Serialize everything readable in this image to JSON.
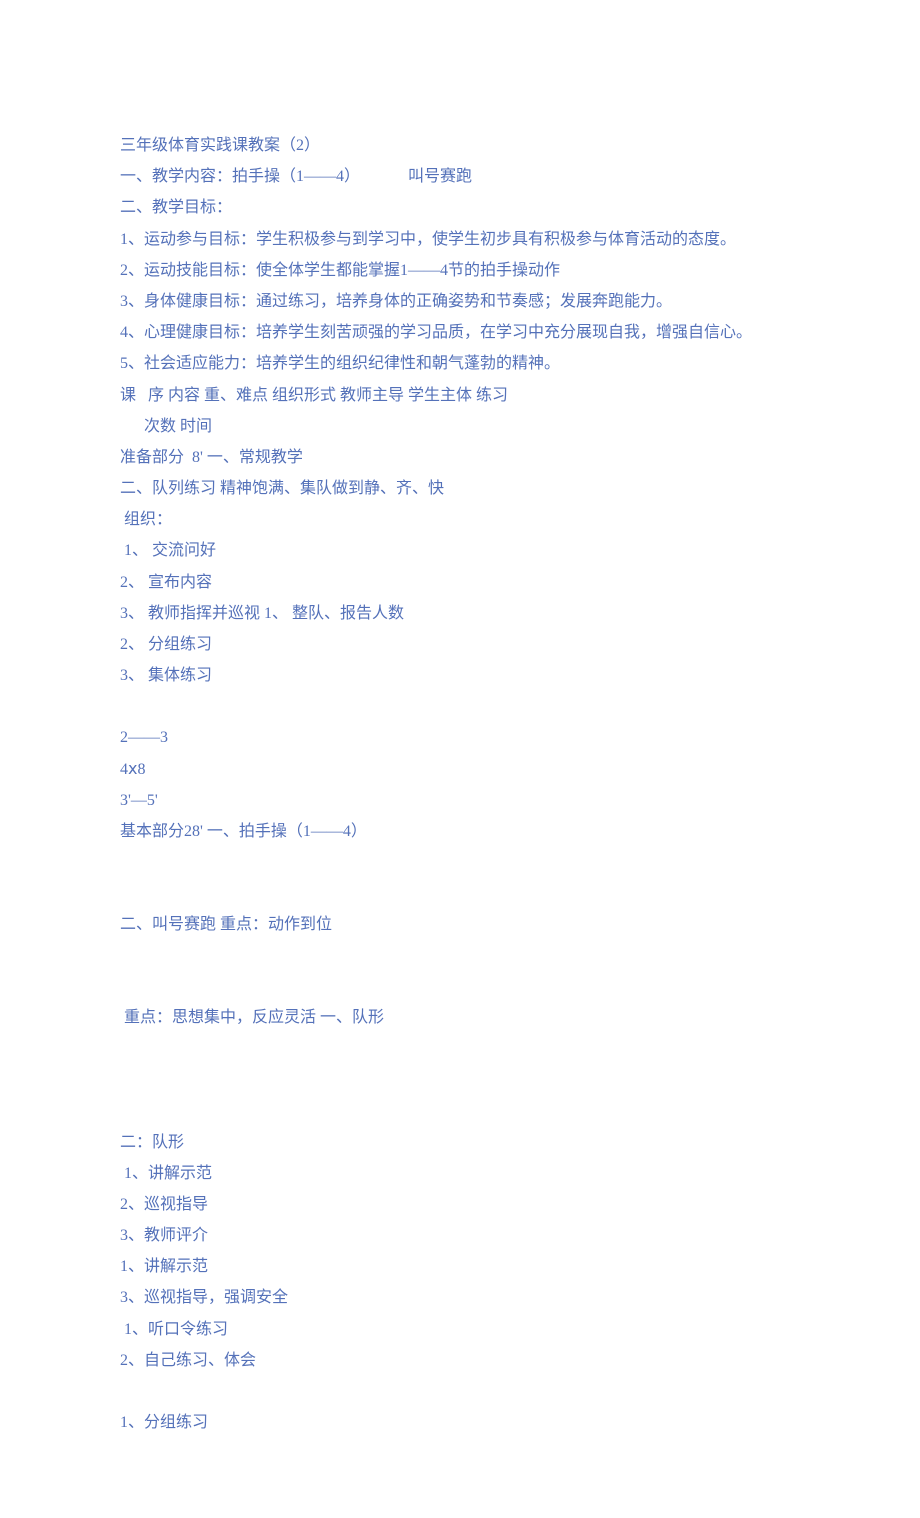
{
  "lines": {
    "l1": "三年级体育实践课教案（2）",
    "l2": "一、教学内容：拍手操（1——4）            叫号赛跑",
    "l3": "二、教学目标：",
    "l4": "1、运动参与目标：学生积极参与到学习中，使学生初步具有积极参与体育活动的态度。",
    "l5": "2、运动技能目标：使全体学生都能掌握1——4节的拍手操动作",
    "l6": "3、身体健康目标：通过练习，培养身体的正确姿势和节奏感；发展奔跑能力。",
    "l7": "4、心理健康目标：培养学生刻苦顽强的学习品质，在学习中充分展现自我，增强自信心。",
    "l8": "5、社会适应能力：培养学生的组织纪律性和朝气蓬勃的精神。",
    "l9": "课   序 内容 重、难点 组织形式 教师主导 学生主体 练习",
    "l10": "      次数 时间",
    "l11": "准备部分  8' 一、常规教学",
    "l12": "二、队列练习 精神饱满、集队做到静、齐、快",
    "l13": " 组织：",
    "l14": " 1、 交流问好",
    "l15": "2、 宣布内容",
    "l16": "3、 教师指挥并巡视 1、 整队、报告人数",
    "l17": "2、 分组练习",
    "l18": "3、 集体练习",
    "l19": "2——3",
    "l20": "4ⅹ8",
    "l21": "3'—5'",
    "l22": "基本部分28' 一、拍手操（1——4）",
    "l23": "二、叫号赛跑 重点：动作到位",
    "l24": " 重点：思想集中，反应灵活 一、队形",
    "l25": "二：队形",
    "l26": " 1、讲解示范",
    "l27": "2、巡视指导",
    "l28": "3、教师评介",
    "l29": "1、讲解示范",
    "l30": "3、巡视指导，强调安全",
    "l31": " 1、听口令练习",
    "l32": "2、自己练习、体会",
    "l33": "1、分组练习"
  }
}
